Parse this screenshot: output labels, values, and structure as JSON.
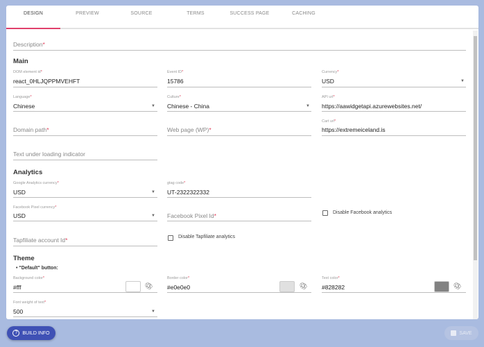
{
  "tabs": [
    "DESIGN",
    "PREVIEW",
    "SOURCE",
    "TERMS",
    "SUCCESS PAGE",
    "CACHING"
  ],
  "description": {
    "placeholder": "Description"
  },
  "main": {
    "heading": "Main",
    "dom_id": {
      "label": "DOM element id",
      "value": "react_0HLJQPPMVEHFT"
    },
    "event_id": {
      "label": "Event ID",
      "value": "15786"
    },
    "currency": {
      "label": "Currency",
      "value": "USD"
    },
    "language": {
      "label": "Language",
      "value": "Chinese"
    },
    "culture": {
      "label": "Culture",
      "value": "Chinese - China"
    },
    "api_url": {
      "label": "API url",
      "value": "https://aawidgetapi.azurewebsites.net/"
    },
    "domain_path": {
      "placeholder": "Domain path"
    },
    "web_page": {
      "placeholder": "Web page (WP)"
    },
    "cart_url": {
      "label": "Cart url",
      "value": "https://extremeiceland.is"
    },
    "loading_text": {
      "placeholder": "Text under loading indicator"
    }
  },
  "analytics": {
    "heading": "Analytics",
    "ga_currency": {
      "label": "Google Analytics currency",
      "value": "USD"
    },
    "gtag": {
      "label": "gtag code",
      "value": "UT-2322322332"
    },
    "fb_currency": {
      "label": "Facebook Pixel currency",
      "value": "USD"
    },
    "fb_pixel": {
      "placeholder": "Facebook Pixel Id"
    },
    "disable_fb": "Disable Facebook analytics",
    "tapfiliate": {
      "placeholder": "Tapfiliate account Id"
    },
    "disable_tap": "Disable Tapfiliate analytics"
  },
  "theme": {
    "heading": "Theme",
    "bullet": "\"Default\" button:",
    "bg": {
      "label": "Background color",
      "value": "#fff",
      "swatch": "#ffffff"
    },
    "border": {
      "label": "Border color",
      "value": "#e0e0e0",
      "swatch": "#e0e0e0"
    },
    "text": {
      "label": "Text color",
      "value": "#828282",
      "swatch": "#828282"
    },
    "font_weight": {
      "label": "Font weight of text",
      "value": "500"
    }
  },
  "footer": {
    "build_info": "BUILD INFO",
    "save": "SAVE"
  },
  "colors": {
    "accent": "#e0406b",
    "build_btn": "#3f51b5",
    "background": "#a9bbe0"
  }
}
